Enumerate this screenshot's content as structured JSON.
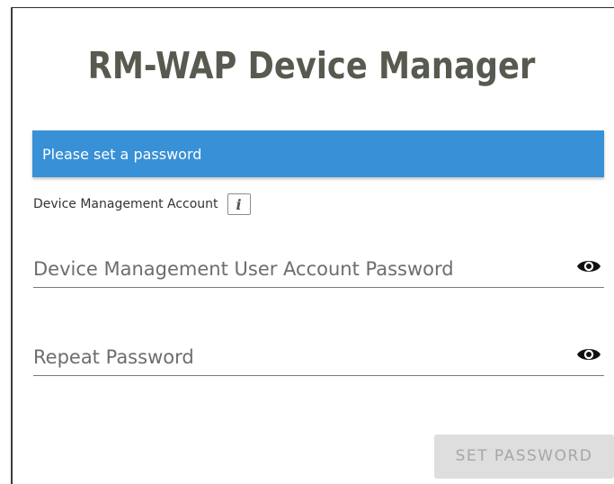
{
  "header": {
    "title": "RM-WAP Device Manager"
  },
  "banner": {
    "message": "Please set a password",
    "color": "#3890d6"
  },
  "account": {
    "label": "Device Management Account",
    "info_icon": "info-icon",
    "info_glyph": "i"
  },
  "fields": [
    {
      "placeholder": "Device Management User Account Password",
      "value": "",
      "icon": "eye-icon"
    },
    {
      "placeholder": "Repeat Password",
      "value": "",
      "icon": "eye-icon"
    }
  ],
  "actions": {
    "set_password_label": "SET PASSWORD",
    "set_password_enabled": false
  }
}
